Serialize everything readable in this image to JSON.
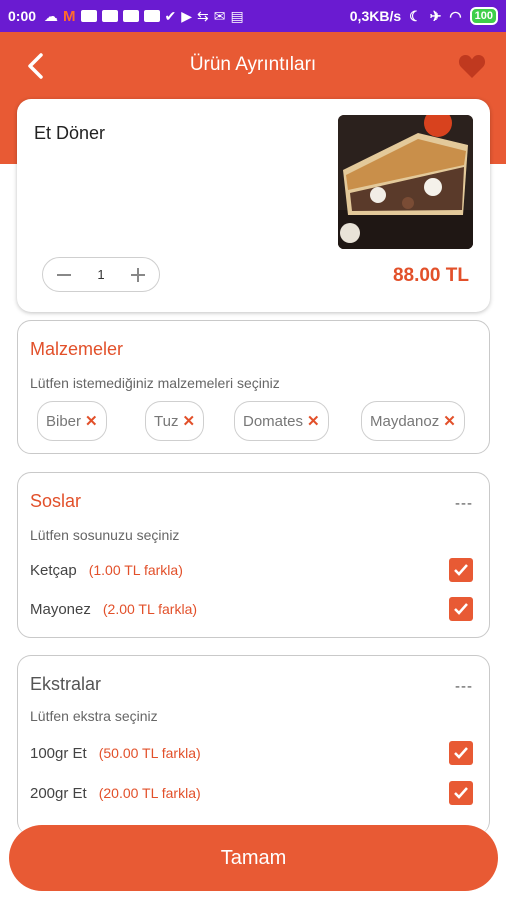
{
  "status_bar": {
    "time": "0:00",
    "network_speed": "0,3KB/s",
    "battery": "100",
    "colors": {
      "background": "#6a1bd1",
      "battery": "#3ecf4a"
    }
  },
  "header": {
    "title": "Ürün Ayrıntıları",
    "back_icon": "back-arrow-icon",
    "favorite_icon": "heart-icon",
    "color": "#e85a34"
  },
  "product": {
    "name": "Et Döner",
    "quantity": "1",
    "price": "88.00 TL"
  },
  "ingredients": {
    "title": "Malzemeler",
    "subtitle": "Lütfen istemediğiniz malzemeleri seçiniz",
    "items": [
      "Biber",
      "Tuz",
      "Domates",
      "Maydanoz"
    ]
  },
  "sauces": {
    "title": "Soslar",
    "dash": "---",
    "subtitle": "Lütfen sosunuzu seçiniz",
    "options": [
      {
        "name": "Ketçap",
        "price": "(1.00 TL farkla)",
        "checked": true
      },
      {
        "name": "Mayonez",
        "price": "(2.00 TL farkla)",
        "checked": true
      }
    ]
  },
  "extras": {
    "title": "Ekstralar",
    "dash": "---",
    "subtitle": "Lütfen ekstra seçiniz",
    "options": [
      {
        "name": "100gr Et",
        "price": "(50.00 TL farkla)",
        "checked": true
      },
      {
        "name": "200gr Et",
        "price": "(20.00 TL farkla)",
        "checked": true
      }
    ]
  },
  "footer": {
    "done_label": "Tamam"
  },
  "accent_color": "#e2502a"
}
